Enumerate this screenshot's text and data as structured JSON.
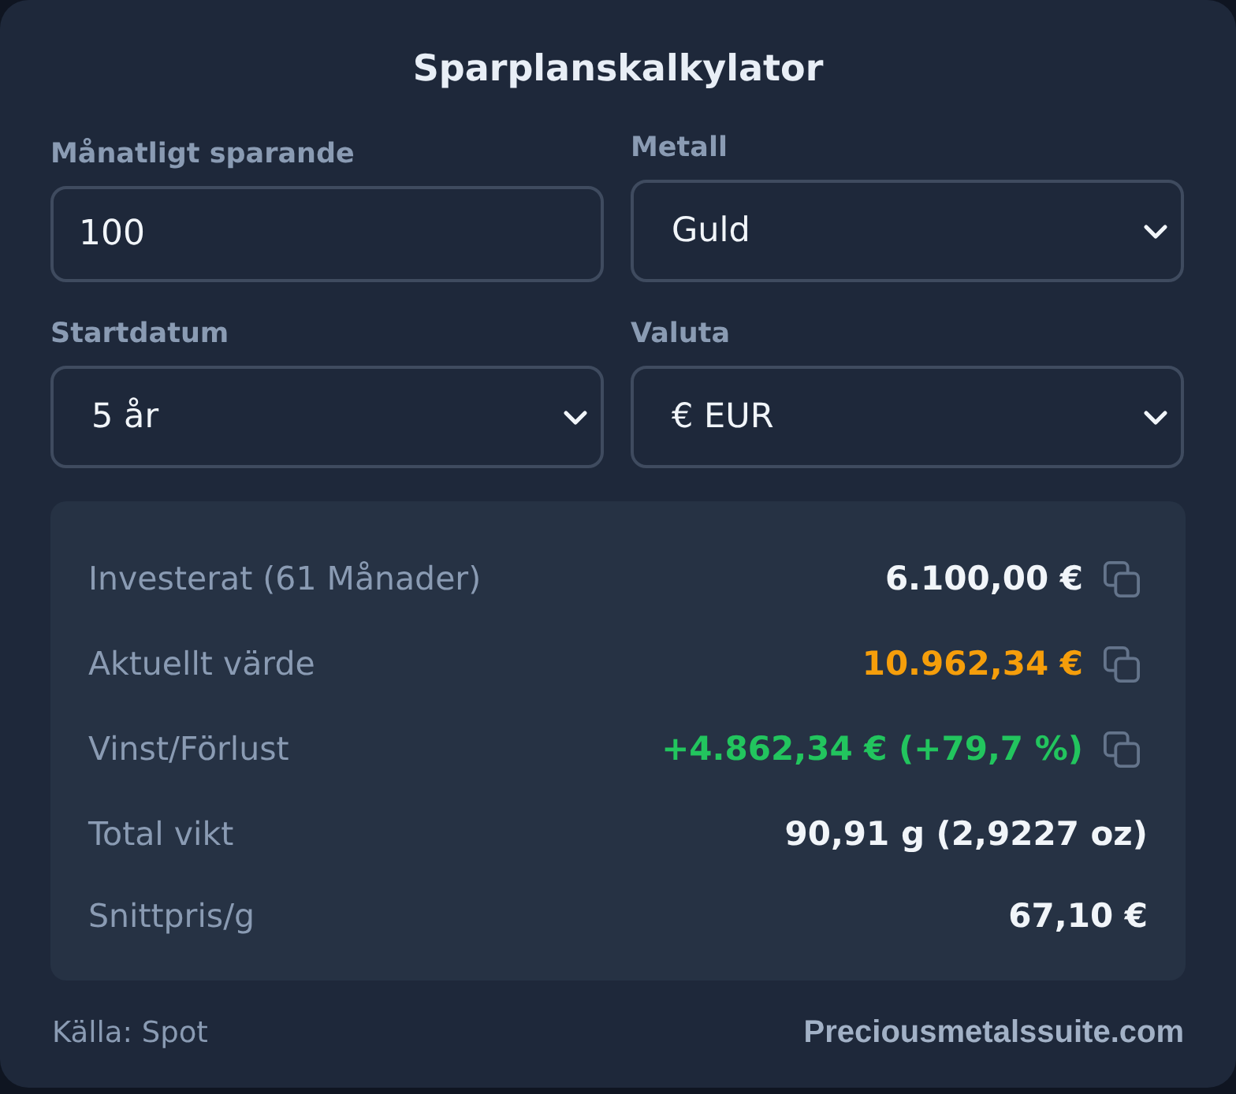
{
  "title": "Sparplanskalkylator",
  "fields": [
    {
      "label": "Månatligt sparande",
      "kind": "input",
      "value": "100"
    },
    {
      "label": "Metall",
      "kind": "select",
      "value": "Guld"
    },
    {
      "label": "Startdatum",
      "kind": "select",
      "value": "5 år"
    },
    {
      "label": "Valuta",
      "kind": "select",
      "value": "€ EUR"
    }
  ],
  "results": [
    {
      "label": "Investerat (61 Månader)",
      "value": "6.100,00 €",
      "color": "#f1f5f9",
      "copyable": true
    },
    {
      "label": "Aktuellt värde",
      "value": "10.962,34 €",
      "color": "#f59e0b",
      "copyable": true
    },
    {
      "label": "Vinst/Förlust",
      "value": "+4.862,34 € (+79,7 %)",
      "color": "#22c55e",
      "copyable": true
    },
    {
      "label": "Total vikt",
      "value": "90,91 g (2,9227 oz)",
      "color": "#f1f5f9",
      "copyable": false
    },
    {
      "label": "Snittpris/g",
      "value": "67,10 €",
      "color": "#f1f5f9",
      "copyable": false
    }
  ],
  "footer": {
    "source": "Källa: Spot",
    "link": "Preciousmetalssuite.com"
  }
}
